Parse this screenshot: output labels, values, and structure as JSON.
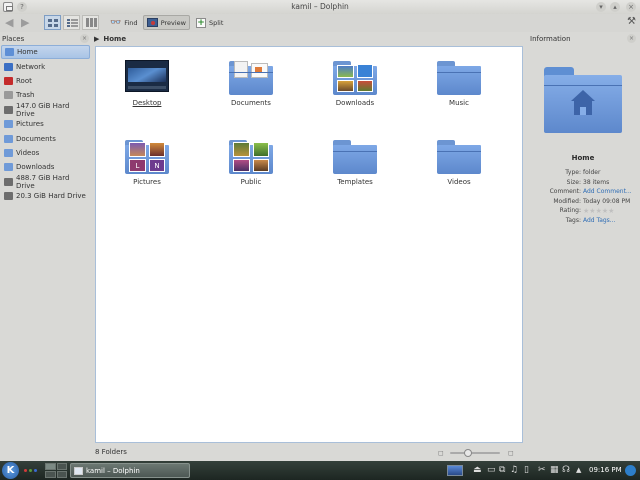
{
  "window": {
    "title": "kamil – Dolphin"
  },
  "toolbar": {
    "find_label": "Find",
    "preview_label": "Preview",
    "split_label": "Split"
  },
  "places": {
    "header": "Places",
    "items": [
      {
        "label": "Home",
        "icon": "home-icon",
        "color": "#5e8fd6",
        "selected": true
      },
      {
        "label": "Network",
        "icon": "network-icon",
        "color": "#3b6fc4"
      },
      {
        "label": "Root",
        "icon": "root-folder-icon",
        "color": "#c42b2b"
      },
      {
        "label": "Trash",
        "icon": "trash-icon",
        "color": "#9a9a9a"
      },
      {
        "label": "147.0 GiB Hard Drive",
        "icon": "hard-drive-icon",
        "color": "#6d6d6d"
      },
      {
        "label": "Pictures",
        "icon": "folder-icon",
        "color": "#6f9ad8"
      },
      {
        "label": "Documents",
        "icon": "folder-icon",
        "color": "#6f9ad8"
      },
      {
        "label": "Videos",
        "icon": "folder-icon",
        "color": "#6f9ad8"
      },
      {
        "label": "Downloads",
        "icon": "folder-icon",
        "color": "#6f9ad8"
      },
      {
        "label": "488.7 GiB Hard Drive",
        "icon": "hard-drive-icon",
        "color": "#6d6d6d"
      },
      {
        "label": "20.3 GiB Hard Drive",
        "icon": "hard-drive-icon",
        "color": "#6d6d6d"
      }
    ]
  },
  "breadcrumb": {
    "current": "Home"
  },
  "files": [
    {
      "label": "Desktop",
      "icon": "desktop-folder-icon"
    },
    {
      "label": "Documents",
      "icon": "documents-folder-icon"
    },
    {
      "label": "Downloads",
      "icon": "downloads-folder-icon"
    },
    {
      "label": "Music",
      "icon": "music-folder-icon"
    },
    {
      "label": "Pictures",
      "icon": "pictures-folder-icon"
    },
    {
      "label": "Public",
      "icon": "public-folder-icon"
    },
    {
      "label": "Templates",
      "icon": "templates-folder-icon"
    },
    {
      "label": "Videos",
      "icon": "videos-folder-icon"
    }
  ],
  "status": {
    "text": "8 Folders"
  },
  "info": {
    "header": "Information",
    "name": "Home",
    "rows": [
      {
        "key": "Type:",
        "value": "folder"
      },
      {
        "key": "Size:",
        "value": "38 items"
      },
      {
        "key": "Comment:",
        "value": "Add Comment...",
        "link": true
      },
      {
        "key": "Modified:",
        "value": "Today 09:08 PM"
      },
      {
        "key": "Rating:",
        "value": ""
      },
      {
        "key": "Tags:",
        "value": "Add Tags...",
        "link": true
      }
    ]
  },
  "taskbar": {
    "task_label": "kamil – Dolphin",
    "clock": "09:16 PM"
  },
  "colors": {
    "accent": "#a9c4e6",
    "folder": "#6f9ad8",
    "link": "#2f6db5"
  }
}
